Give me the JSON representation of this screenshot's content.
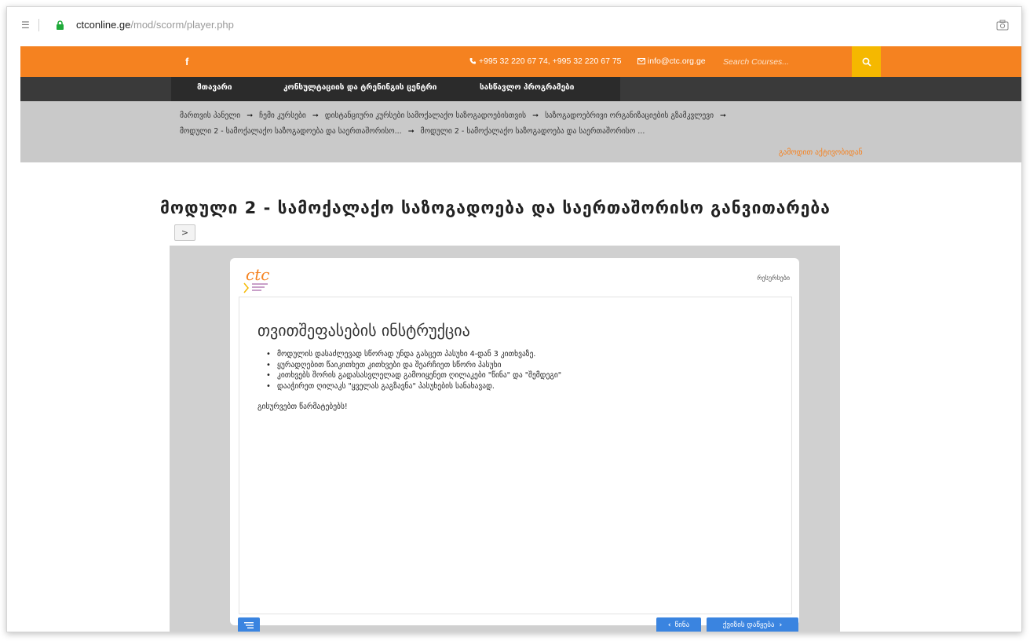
{
  "browser": {
    "menu_glyph": "☰",
    "url_host": "ctconline.ge",
    "url_path": "/mod/scorm/player.php"
  },
  "topbar": {
    "facebook": "f",
    "phone": "+995 32 220 67 74, +995 32 220 67 75",
    "email": "info@ctc.org.ge",
    "search_placeholder": "Search Courses..."
  },
  "nav": {
    "items": [
      "მთავარი",
      "კონსულტაციის და ტრენინგის ცენტრი",
      "სასწავლო პროგრამები"
    ]
  },
  "breadcrumb": {
    "items": [
      "მართვის პანელი",
      "ჩემი კურსები",
      "დისტანციური კურსები სამოქალაქო საზოგადოებისთვის",
      "საზოგადოებრივი ორგანიზაციების გზამკვლევი",
      "მოდული 2 - სამოქალაქო საზოგადოება და საერთაშორისო...",
      "მოდული 2 - სამოქალაქო საზოგადოება და საერთაშორისო ..."
    ],
    "exit": "გამოდით აქტივობიდან"
  },
  "page": {
    "title": "მოდული 2 - სამოქალაქო საზოგადოება და საერთაშორისო განვითარება",
    "toggle": ">"
  },
  "player": {
    "logo_text": "ctc",
    "resources": "რესურსები",
    "heading": "თვითშეფასების ინსტრუქცია",
    "bullets": [
      "მოდულის დასაძლევად სწორად უნდა გასცეთ პასუხი 4-დან 3 კითხვაზე.",
      "ყურადღებით წაიკითხეთ კითხვები და შეარჩიეთ სწორი პასუხი",
      "კითხვებს შორის გადასასვლელად გამოიყენეთ ღილაკები \"წინა\" და \"შემდეგი\"",
      "დააჭირეთ ღილაკს \"ყველას გაგზავნა\" პასუხების სანახავად."
    ],
    "closing": "გისურვებთ წარმატებებს!",
    "prev_label": "წინა",
    "next_label": "ქვიზის დაწყება"
  },
  "colors": {
    "accent_orange": "#f58220",
    "search_yellow": "#f5b800",
    "nav_dark": "#3a3a3a",
    "button_blue": "#3a84e0"
  }
}
